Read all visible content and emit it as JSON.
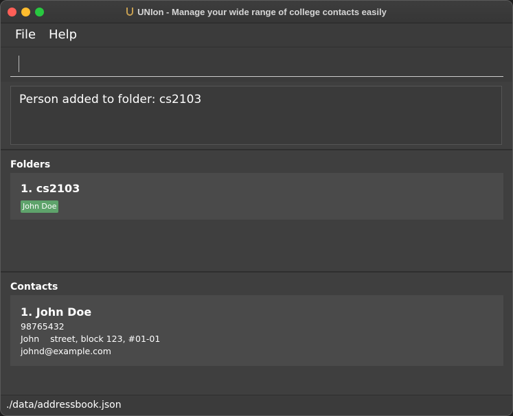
{
  "window": {
    "title": "UNIon - Manage your wide range of college contacts easily"
  },
  "menu": {
    "file": "File",
    "help": "Help"
  },
  "command": {
    "value": ""
  },
  "result": {
    "message": "Person added to folder: cs2103"
  },
  "folders": {
    "label": "Folders",
    "items": [
      {
        "index_name": "1.  cs2103",
        "members": [
          "John Doe"
        ]
      }
    ]
  },
  "contacts": {
    "label": "Contacts",
    "items": [
      {
        "index_name": "1.  John Doe",
        "phone": "98765432",
        "address": "John    street, block 123, #01-01",
        "email": "johnd@example.com"
      }
    ]
  },
  "status": {
    "path": "./data/addressbook.json"
  },
  "colors": {
    "tag_bg": "#5ea36b",
    "window_bg": "#3f3f3f",
    "card_bg": "#4a4a4a"
  }
}
